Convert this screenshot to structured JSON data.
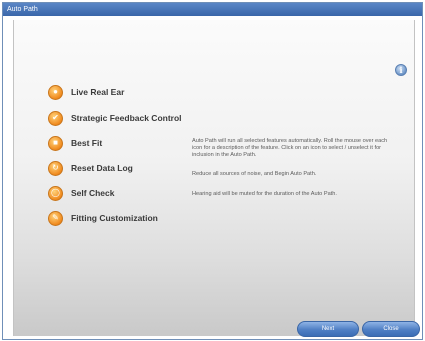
{
  "window": {
    "title": "Auto Path"
  },
  "info_icon": "info-icon",
  "items": [
    {
      "label": "Live Real Ear",
      "icon": "ear-icon"
    },
    {
      "label": "Strategic Feedback Control",
      "icon": "feedback-icon"
    },
    {
      "label": "Best Fit",
      "icon": "best-fit-icon"
    },
    {
      "label": "Reset Data Log",
      "icon": "reset-icon"
    },
    {
      "label": "Self Check",
      "icon": "self-check-icon"
    },
    {
      "label": "Fitting Customization",
      "icon": "customize-icon"
    }
  ],
  "descriptions": {
    "main": "Auto Path will run all selected features automatically. Roll the mouse over each icon for a description of the feature. Click on an icon to select / unselect it for inclusion in the Auto Path.",
    "reset": "Reduce all sources of noise, and Begin Auto Path.",
    "note": "Hearing aid will be muted for the duration of the Auto Path."
  },
  "buttons": {
    "next": "Next",
    "close": "Close"
  },
  "colors": {
    "accent": "#4f7fc4",
    "icon_orange": "#f08a1e",
    "title_bar": "#3a67aa"
  }
}
